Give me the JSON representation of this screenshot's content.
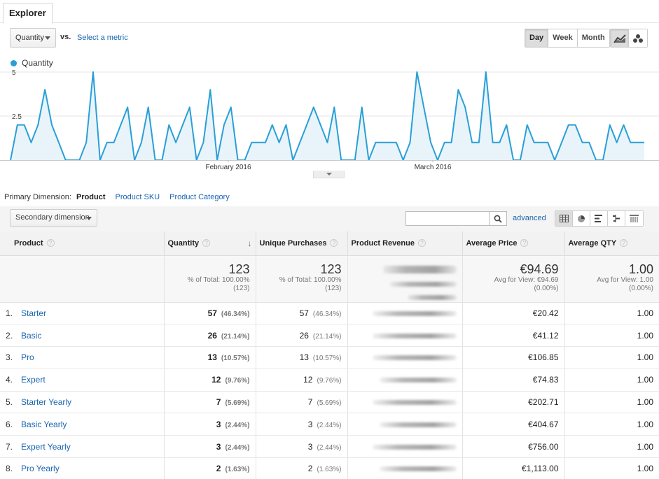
{
  "tabs": {
    "explorer": "Explorer"
  },
  "metric": {
    "selected": "Quantity",
    "vs": "vs.",
    "select_metric": "Select a metric"
  },
  "period": {
    "day": "Day",
    "week": "Week",
    "month": "Month",
    "active": "Day"
  },
  "legend": {
    "label": "Quantity"
  },
  "colors": {
    "series": "#2a9fd6",
    "fill": "#e8f4fa",
    "link": "#1a65b0"
  },
  "chart_data": {
    "type": "line",
    "series": [
      {
        "name": "Quantity",
        "values": [
          0,
          2,
          2,
          1,
          2,
          4,
          2,
          1,
          0,
          0,
          0,
          1,
          5,
          0,
          1,
          1,
          2,
          3,
          0,
          1,
          3,
          0,
          0,
          2,
          1,
          2,
          3,
          0,
          1,
          4,
          0,
          2,
          3,
          0,
          0,
          1,
          1,
          1,
          2,
          1,
          2,
          0,
          1,
          2,
          3,
          2,
          1,
          3,
          0,
          0,
          0,
          3,
          0,
          1,
          1,
          1,
          1,
          0,
          1,
          5,
          3,
          1,
          0,
          1,
          1,
          4,
          3,
          1,
          1,
          5,
          1,
          1,
          2,
          0,
          0,
          2,
          1,
          1,
          1,
          0,
          1,
          2,
          2,
          1,
          1,
          0,
          0,
          2,
          1,
          2,
          1,
          1,
          1
        ]
      }
    ],
    "x_tick_labels": [
      "February 2016",
      "March 2016"
    ],
    "y_tick_labels": [
      "5",
      "2.5"
    ],
    "ylim": [
      0,
      5
    ],
    "grid": true,
    "icon_names": [
      "line-chart-icon",
      "motion-chart-icon"
    ]
  },
  "primary_dimension": {
    "label": "Primary Dimension:",
    "active": "Product",
    "links": [
      "Product SKU",
      "Product Category"
    ]
  },
  "controls": {
    "secondary_dimension": "Secondary dimension",
    "search_placeholder": "",
    "advanced": "advanced"
  },
  "table": {
    "headers": [
      "Product",
      "Quantity",
      "Unique Purchases",
      "Product Revenue",
      "Average Price",
      "Average QTY"
    ],
    "totals": {
      "quantity": {
        "main": "123",
        "sub1": "% of Total: 100.00%",
        "sub2": "(123)"
      },
      "unique": {
        "main": "123",
        "sub1": "% of Total: 100.00%",
        "sub2": "(123)"
      },
      "avg_price": {
        "main": "€94.69",
        "sub1": "Avg for View: €94.69",
        "sub2": "(0.00%)"
      },
      "avg_qty": {
        "main": "1.00",
        "sub1": "Avg for View: 1.00",
        "sub2": "(0.00%)"
      }
    },
    "rows": [
      {
        "idx": "1.",
        "name": "Starter",
        "qty": "57",
        "qty_pct": "(46.34%)",
        "up": "57",
        "up_pct": "(46.34%)",
        "price": "€20.42",
        "avg_qty": "1.00"
      },
      {
        "idx": "2.",
        "name": "Basic",
        "qty": "26",
        "qty_pct": "(21.14%)",
        "up": "26",
        "up_pct": "(21.14%)",
        "price": "€41.12",
        "avg_qty": "1.00"
      },
      {
        "idx": "3.",
        "name": "Pro",
        "qty": "13",
        "qty_pct": "(10.57%)",
        "up": "13",
        "up_pct": "(10.57%)",
        "price": "€106.85",
        "avg_qty": "1.00"
      },
      {
        "idx": "4.",
        "name": "Expert",
        "qty": "12",
        "qty_pct": "(9.76%)",
        "up": "12",
        "up_pct": "(9.76%)",
        "price": "€74.83",
        "avg_qty": "1.00"
      },
      {
        "idx": "5.",
        "name": "Starter Yearly",
        "qty": "7",
        "qty_pct": "(5.69%)",
        "up": "7",
        "up_pct": "(5.69%)",
        "price": "€202.71",
        "avg_qty": "1.00"
      },
      {
        "idx": "6.",
        "name": "Basic Yearly",
        "qty": "3",
        "qty_pct": "(2.44%)",
        "up": "3",
        "up_pct": "(2.44%)",
        "price": "€404.67",
        "avg_qty": "1.00"
      },
      {
        "idx": "7.",
        "name": "Expert Yearly",
        "qty": "3",
        "qty_pct": "(2.44%)",
        "up": "3",
        "up_pct": "(2.44%)",
        "price": "€756.00",
        "avg_qty": "1.00"
      },
      {
        "idx": "8.",
        "name": "Pro Yearly",
        "qty": "2",
        "qty_pct": "(1.63%)",
        "up": "2",
        "up_pct": "(1.63%)",
        "price": "€1,113.00",
        "avg_qty": "1.00"
      }
    ]
  }
}
